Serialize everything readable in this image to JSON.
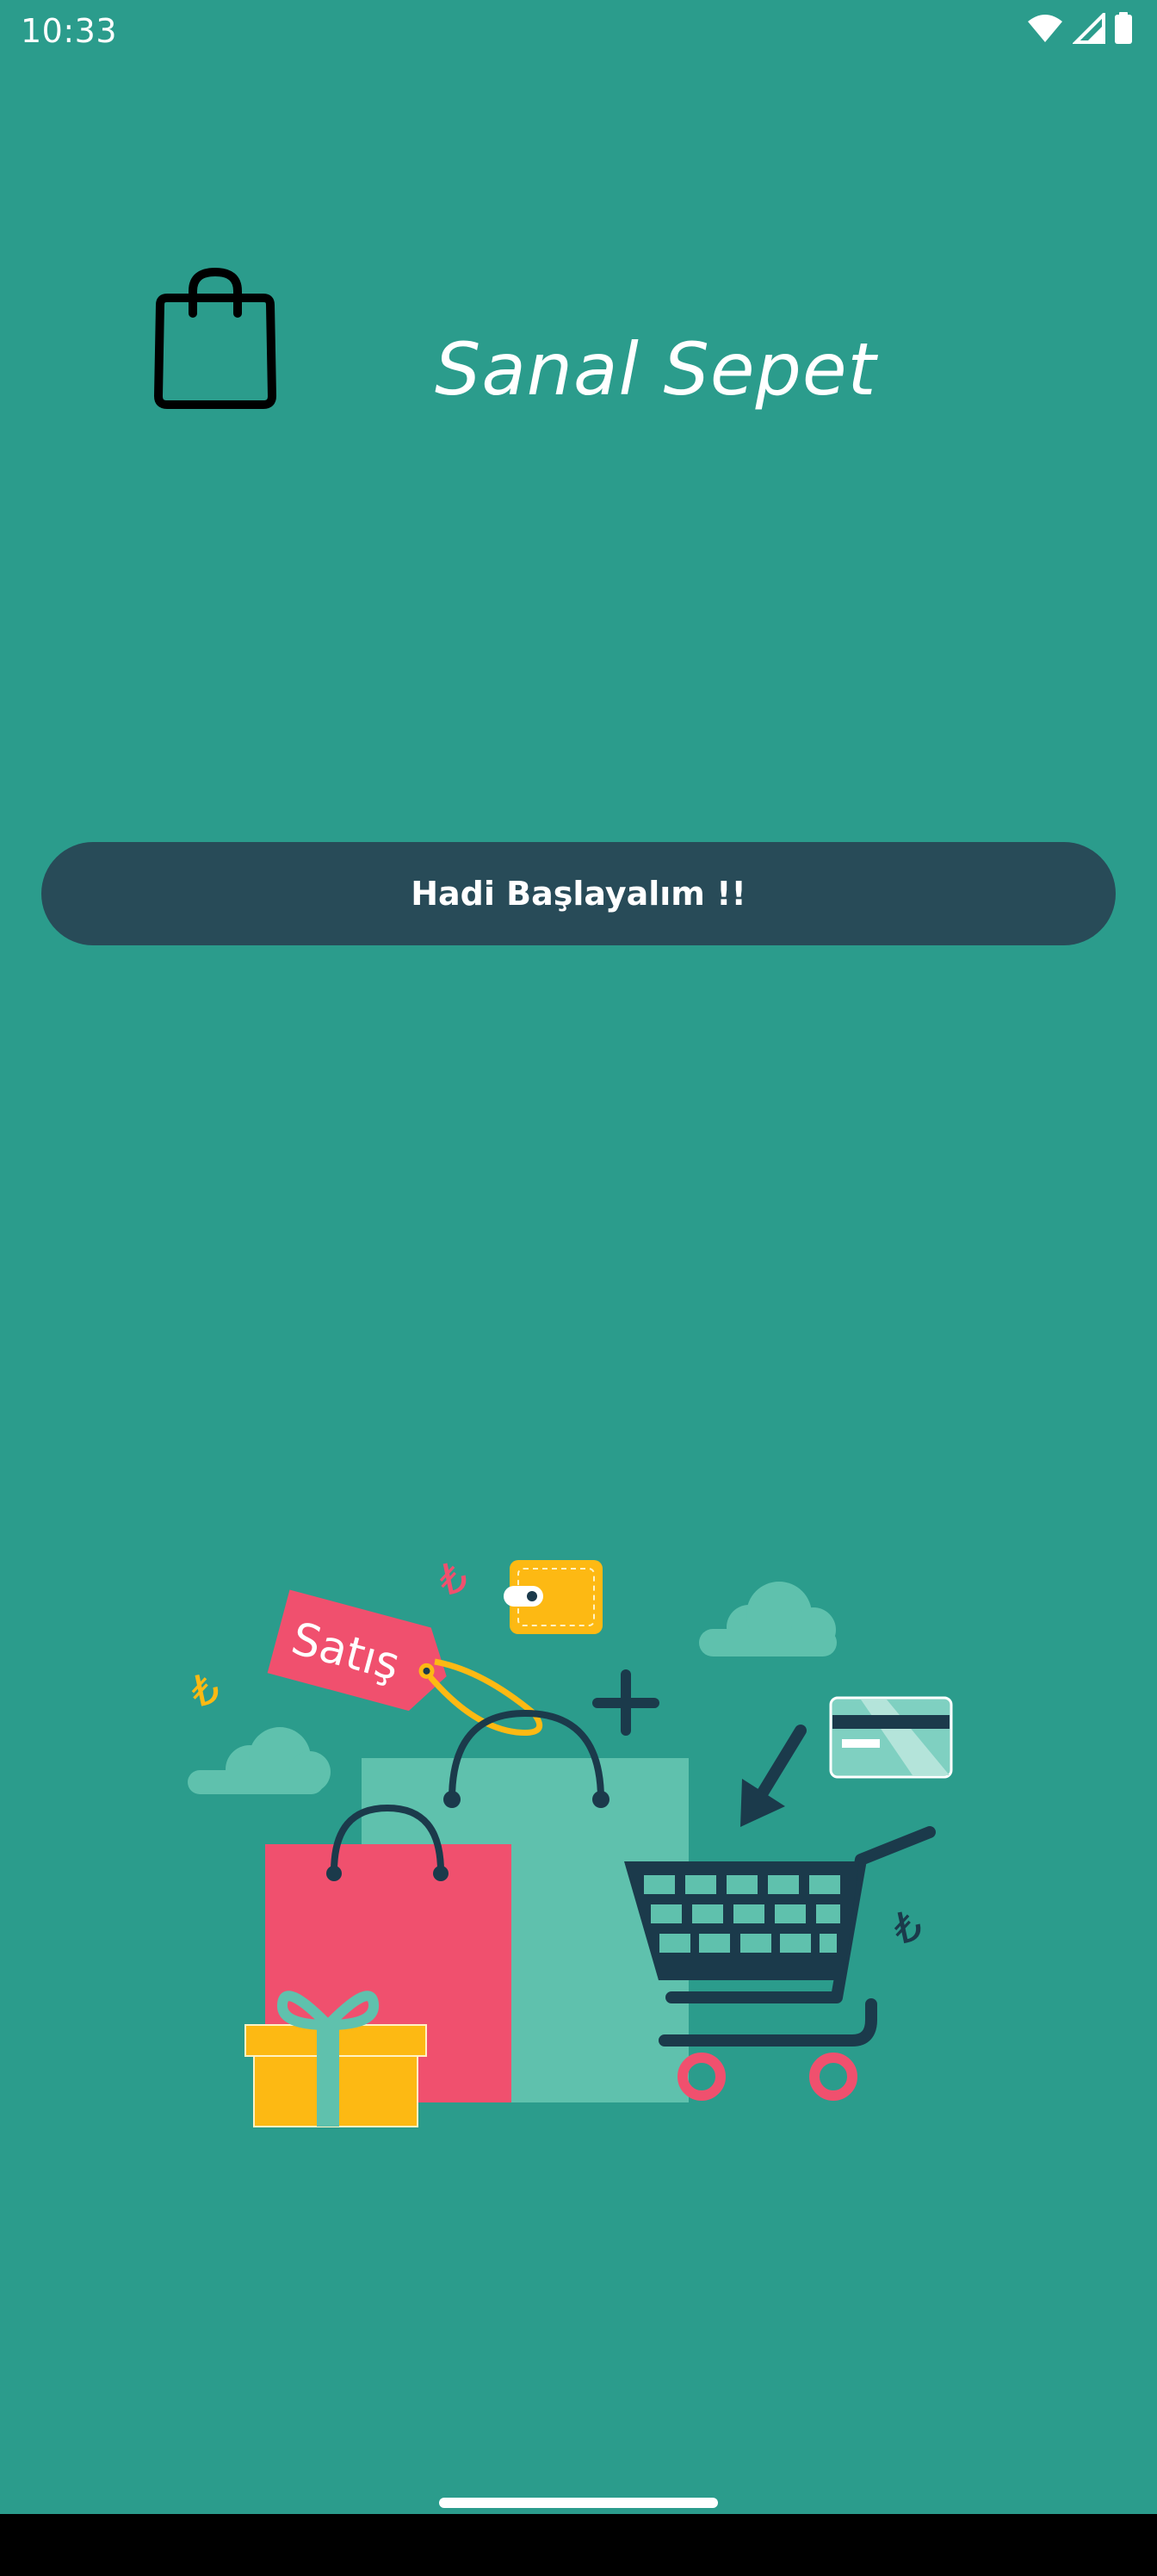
{
  "status_bar": {
    "time": "10:33",
    "icons": [
      "wifi-icon",
      "signal-icon",
      "battery-icon"
    ]
  },
  "header": {
    "logo_icon": "shopping-bag-icon",
    "title": "Sanal Sepet"
  },
  "main": {
    "start_button_label": "Hadi Başlayalım !!"
  },
  "illustration": {
    "sale_tag_text": "Satış",
    "currency_symbol": "₺"
  },
  "colors": {
    "background": "#2b9c8c",
    "button": "#284b58",
    "accent_pink": "#f0506e",
    "accent_yellow": "#fdb913",
    "accent_mint": "#5fc1ad",
    "dark_navy": "#1b3a4b"
  }
}
